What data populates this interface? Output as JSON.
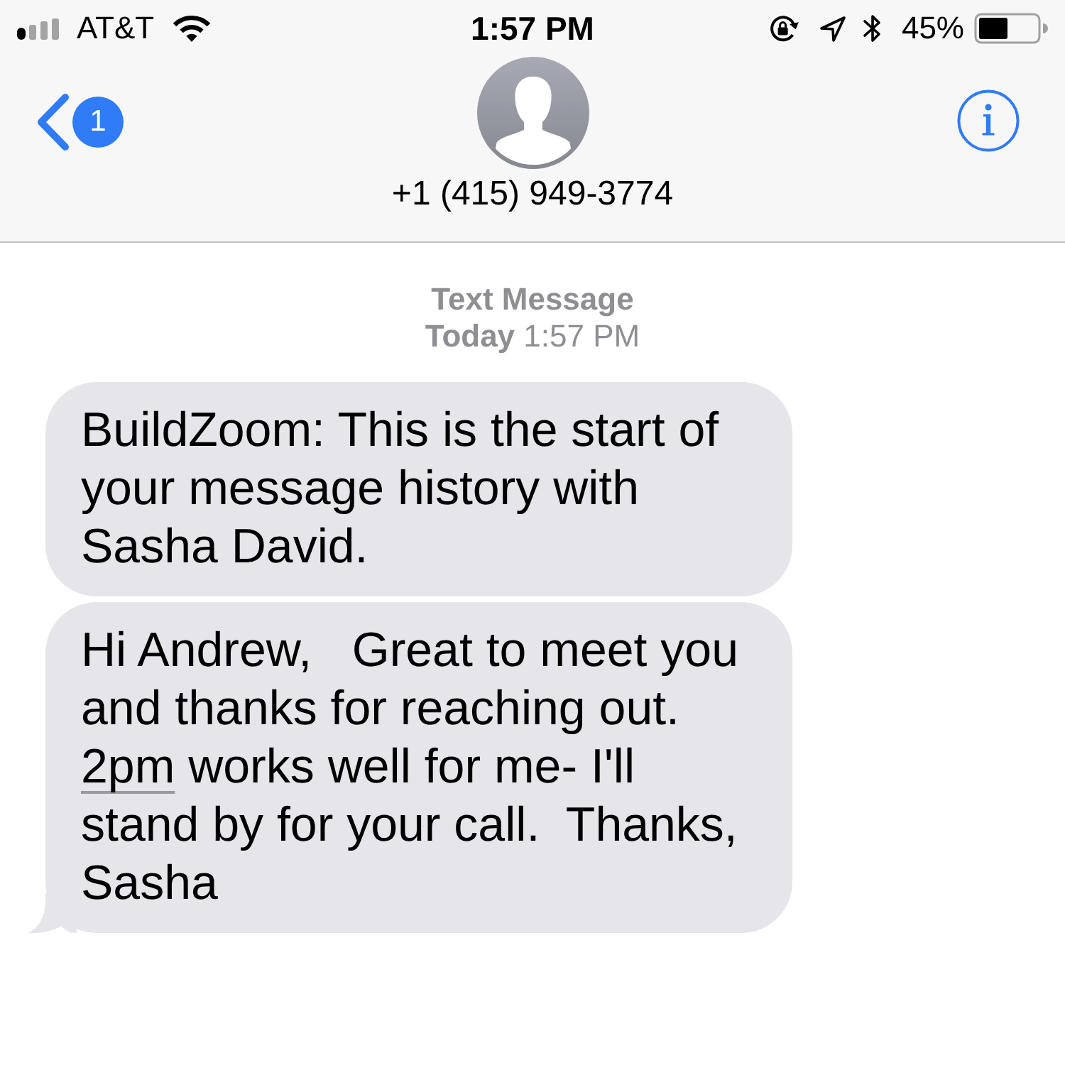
{
  "status_bar": {
    "carrier": "AT&T",
    "time": "1:57 PM",
    "battery": "45%"
  },
  "nav_bar": {
    "back_badge": "1",
    "contact": "+1 (415) 949-3774"
  },
  "thread_header": {
    "service": "Text Message",
    "timestamp": "**Today** 1:57 PM"
  },
  "messages": [
    {
      "tail": false,
      "segments": [
        {
          "kind": "text",
          "text": "BuildZoom: This is the start of your message history with Sasha David."
        }
      ]
    },
    {
      "tail": true,
      "segments": [
        {
          "kind": "text",
          "text": "Hi Andrew,   Great to meet you and thanks for reaching out. "
        },
        {
          "kind": "link",
          "text": "2pm"
        },
        {
          "kind": "text",
          "text": " works well for me- I'll stand by for your call.  Thanks, Sasha"
        }
      ]
    }
  ]
}
